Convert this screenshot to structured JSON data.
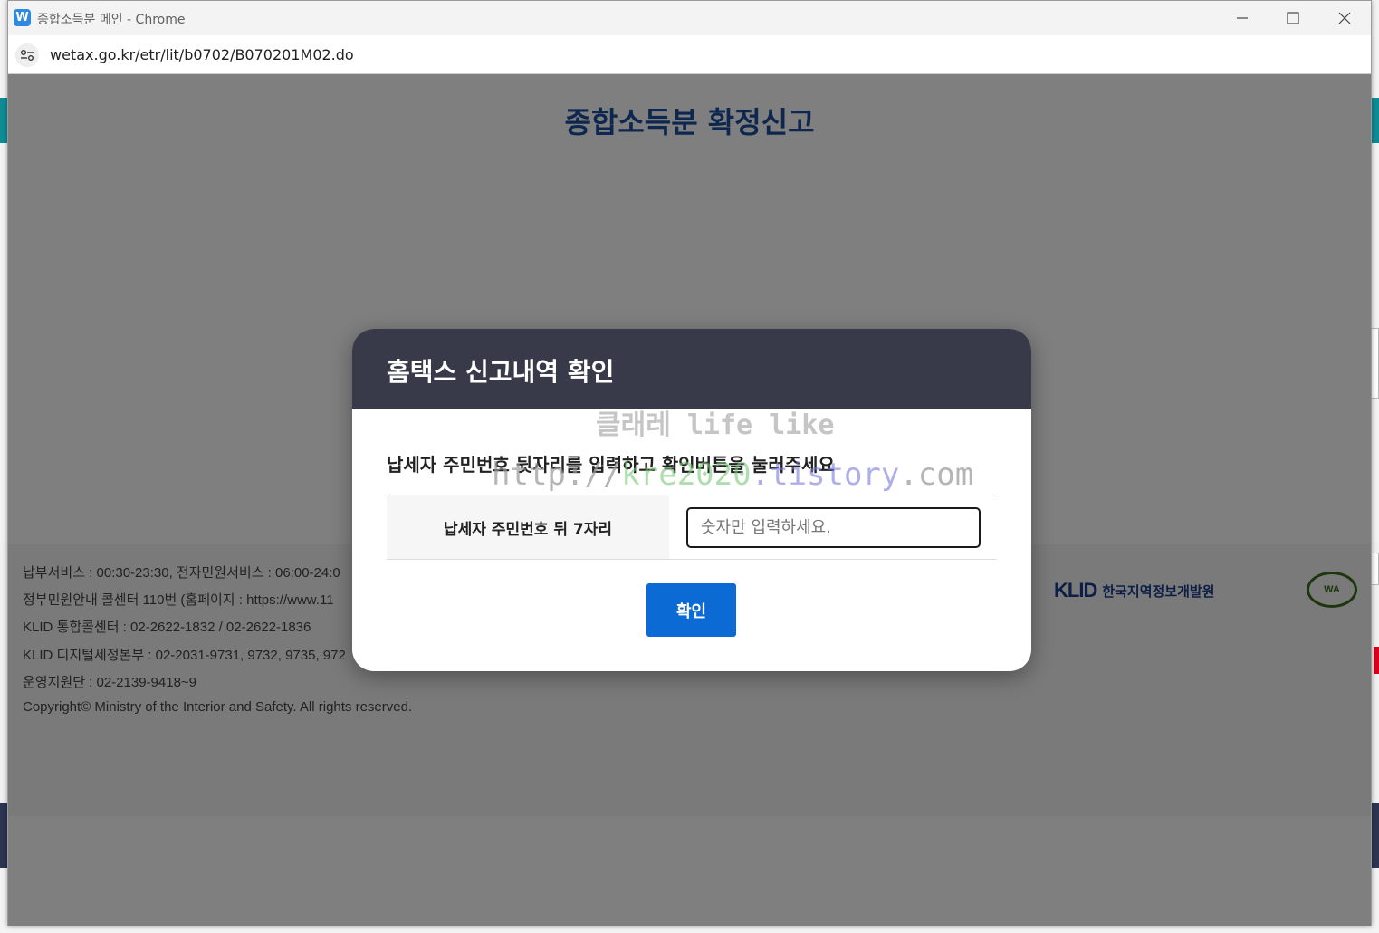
{
  "window": {
    "app_icon_letter": "W",
    "title": "종합소득분 메인 - Chrome"
  },
  "address_bar": {
    "url": "wetax.go.kr/etr/lit/b0702/B070201M02.do"
  },
  "page": {
    "title": "종합소득분 확정신고",
    "footer_lines": [
      "납부서비스 : 00:30-23:30, 전자민원서비스 : 06:00-24:0",
      "정부민원안내 콜센터 110번 (홈페이지 : https://www.11",
      "KLID 통합콜센터 : 02-2622-1832 / 02-2622-1836",
      "KLID 디지털세정본부 : 02-2031-9731, 9732, 9735, 972",
      "운영지원단 : 02-2139-9418~9",
      "Copyright© Ministry of the Interior and Safety. All rights reserved."
    ],
    "klid_mark": "KLID",
    "klid_name": "한국지역정보개발원",
    "wa_mark": "WA"
  },
  "modal": {
    "title": "홈택스 신고내역 확인",
    "description": "납세자 주민번호 뒷자리를 입력하고 확인버튼을 눌러주세요",
    "field_label": "납세자 주민번호 뒤 7자리",
    "field_value": "",
    "field_placeholder": "숫자만 입력하세요.",
    "confirm_label": "확인"
  },
  "watermark": {
    "line1": "클래레 life like",
    "line2_a": "http://",
    "line2_b": "kre2020",
    "line2_c": ".tistory",
    "line2_d": ".com"
  },
  "colors": {
    "modal_header": "#383a4a",
    "confirm_button": "#0b6ad4",
    "page_title": "#1a4f9c"
  }
}
